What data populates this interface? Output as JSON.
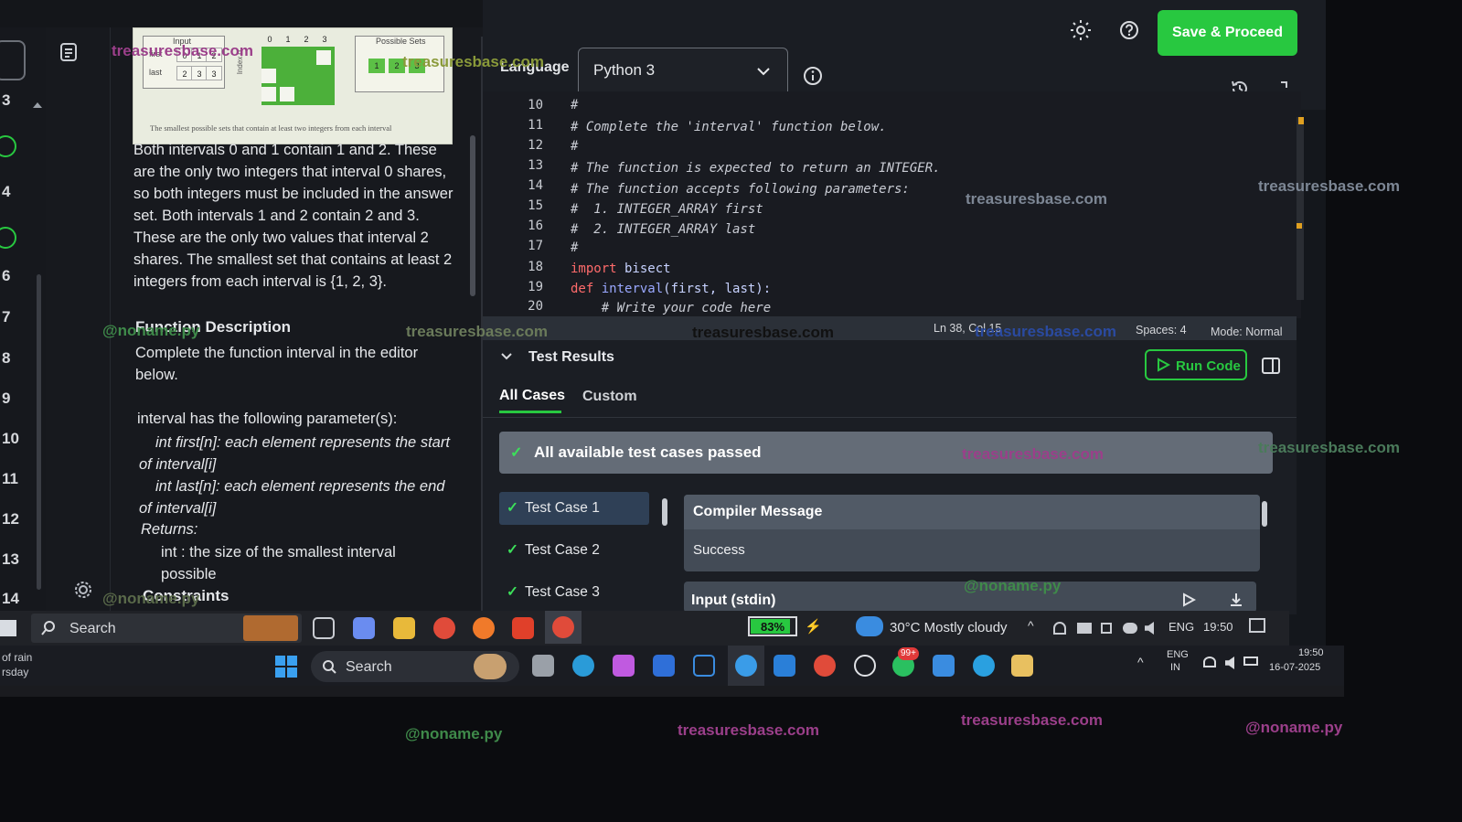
{
  "header": {
    "save_label": "Save & Proceed",
    "language_label": "Language",
    "language_value": "Python 3"
  },
  "rail": {
    "numbers": [
      "3",
      "4",
      "6",
      "7",
      "8",
      "9",
      "10",
      "11",
      "12",
      "13",
      "14"
    ]
  },
  "diagram": {
    "left_title": "Input",
    "first_label": "first",
    "last_label": "last",
    "first_values": [
      "0",
      "1",
      "2"
    ],
    "last_values": [
      "2",
      "3",
      "3"
    ],
    "grid_header": [
      "0",
      "1",
      "2",
      "3"
    ],
    "row_labels": [
      "Index 0",
      "1",
      "2"
    ],
    "right_title": "Possible Sets",
    "right_values": [
      "1",
      "2",
      "3"
    ],
    "caption": "The smallest possible sets that contain at least two integers from each interval"
  },
  "problem": {
    "explanation": "Both intervals 0 and 1 contain 1 and 2. These are the only two integers that interval 0 shares, so both integers must be included in the answer set. Both intervals 1 and 2 contain 2 and 3. These are the only two values that interval 2 shares. The smallest set that contains at least 2 integers from each interval is {1, 2, 3}.",
    "function_heading": "Function Description",
    "function_desc": "Complete the function interval in the editor below.",
    "params_intro": "interval has the following parameter(s):",
    "param_first": "int first[n]:  each element represents the start of interval[i]",
    "param_last": "int last[n]:  each element represents the end of interval[i]",
    "returns_label": "Returns:",
    "returns_value": "int : the size of the smallest interval possible",
    "constraints_heading": "Constraints"
  },
  "editor": {
    "lines": [
      {
        "n": "10",
        "text": "#"
      },
      {
        "n": "11",
        "text": "# Complete the 'interval' function below."
      },
      {
        "n": "12",
        "text": "#"
      },
      {
        "n": "13",
        "text": "# The function is expected to return an INTEGER."
      },
      {
        "n": "14",
        "text": "# The function accepts following parameters:"
      },
      {
        "n": "15",
        "text": "#  1. INTEGER_ARRAY first"
      },
      {
        "n": "16",
        "text": "#  2. INTEGER_ARRAY last"
      },
      {
        "n": "17",
        "text": "#"
      },
      {
        "n": "18",
        "kw": "import",
        "rest": " bisect"
      },
      {
        "n": "19",
        "kw": "def",
        "fn": " interval",
        "rest": "(first, last):"
      },
      {
        "n": "20",
        "text": "    # Write your code here"
      }
    ],
    "status_position": "Ln 38, Col 15",
    "status_spaces": "Spaces: 4",
    "status_mode": "Mode: Normal"
  },
  "results": {
    "title": "Test Results",
    "run_label": "Run Code",
    "tab_all": "All Cases",
    "tab_custom": "Custom",
    "banner": "All available test cases passed",
    "cases": [
      "Test Case 1",
      "Test Case 2",
      "Test Case 3"
    ],
    "compiler_heading": "Compiler Message",
    "compiler_value": "Success",
    "stdin_heading": "Input (stdin)"
  },
  "inner_taskbar": {
    "search_label": "Search",
    "battery": "83%",
    "weather": "30°C  Mostly cloudy",
    "lang": "ENG",
    "time": "19:50"
  },
  "outer_taskbar": {
    "weather_line1": "of rain",
    "weather_line2": "rsday",
    "search_label": "Search",
    "badge": "99+",
    "lang_line1": "ENG",
    "lang_line2": "IN",
    "time": "19:50",
    "date": "16-07-2025"
  },
  "watermarks": {
    "site": "treasuresbase.com",
    "handle": "@noname.py"
  },
  "colors": {
    "accent_green": "#28c840",
    "selected_case": "#2f4056",
    "watermark_purple": "#9b3f8a"
  }
}
